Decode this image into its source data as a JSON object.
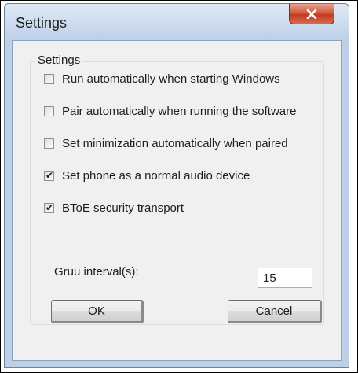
{
  "window": {
    "title": "Settings",
    "close_icon": "close-x-icon",
    "close_color": "#c23a22"
  },
  "group": {
    "label": "Settings"
  },
  "options": [
    {
      "label": "Run automatically when starting Windows",
      "checked": false
    },
    {
      "label": "Pair automatically when running the software",
      "checked": false
    },
    {
      "label": "Set minimization automatically when paired",
      "checked": false
    },
    {
      "label": "Set phone as a normal audio device",
      "checked": true
    },
    {
      "label": "BToE security transport",
      "checked": true
    }
  ],
  "interval": {
    "label": "Gruu interval(s):",
    "value": "15"
  },
  "buttons": {
    "ok": "OK",
    "cancel": "Cancel"
  },
  "check_mark": "✔"
}
